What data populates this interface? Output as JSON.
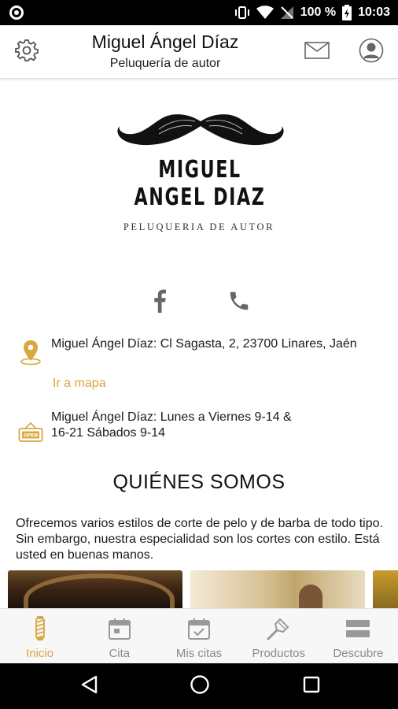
{
  "status_bar": {
    "battery": "100 %",
    "time": "10:03"
  },
  "header": {
    "title": "Miguel Ángel Díaz",
    "subtitle": "Peluquería de autor",
    "icons": {
      "settings": "gear-icon",
      "messages": "mail-icon",
      "profile": "user-icon"
    }
  },
  "logo": {
    "brand": "MIGUEL ANGEL DIAZ",
    "tagline": "PELUQUERIA DE AUTOR"
  },
  "social": {
    "facebook": "facebook-icon",
    "phone": "phone-icon"
  },
  "address": {
    "text": "Miguel Ángel Díaz: Cl Sagasta, 2, 23700 Linares, Jaén",
    "map_link": "Ir a mapa"
  },
  "hours": {
    "line1": "Miguel Ángel Díaz: Lunes a Viernes 9-14 &",
    "line2": "16-21 Sábados 9-14"
  },
  "about": {
    "title": "QUIÉNES SOMOS",
    "text": "Ofrecemos varios estilos de corte de pelo y de barba de todo tipo. Sin embargo, nuestra especialidad son los cortes con estilo. Está usted en buenas manos."
  },
  "bottom_nav": [
    {
      "label": "Inicio",
      "icon": "barber-pole-icon",
      "active": true
    },
    {
      "label": "Cita",
      "icon": "calendar-icon",
      "active": false
    },
    {
      "label": "Mis citas",
      "icon": "calendar-check-icon",
      "active": false
    },
    {
      "label": "Productos",
      "icon": "razor-icon",
      "active": false
    },
    {
      "label": "Descubre",
      "icon": "menu-icon",
      "active": false
    }
  ],
  "colors": {
    "accent": "#d9a740",
    "inactive": "#8a8a8a"
  }
}
